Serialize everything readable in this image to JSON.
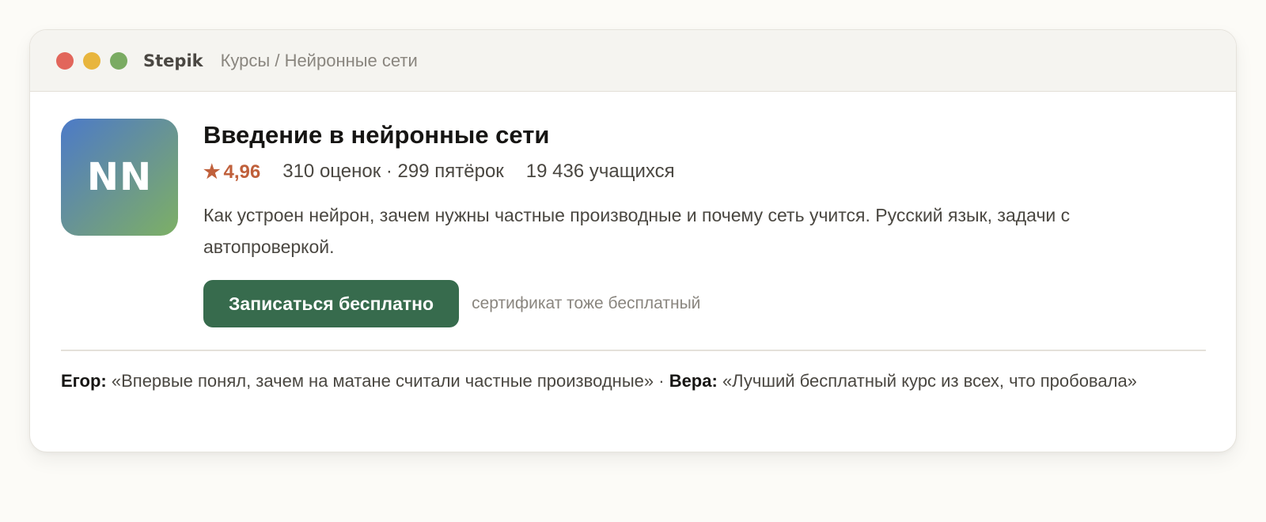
{
  "window": {
    "brand": "Stepik",
    "breadcrumb": "Курсы / Нейронные сети",
    "controls": [
      "close",
      "minimize",
      "maximize"
    ]
  },
  "course": {
    "logo_text": "NN",
    "title": "Введение в нейронные сети",
    "rating_star": "★",
    "rating": "4,96",
    "ratings_summary": "310 оценок · 299 пятёрок",
    "students": "19 436 учащихся",
    "description": "Как устроен нейрон, зачем нужны частные производные и почему сеть учится. Русский язык, задачи с автопроверкой.",
    "enroll_label": "Записаться бесплатно",
    "enroll_note": "сертификат тоже бесплатный"
  },
  "reviews": [
    {
      "author": "Егор:",
      "text": "«Впервые понял, зачем на матане считали частные производные»"
    },
    {
      "author": "Вера:",
      "text": "«Лучший бесплатный курс из всех, что пробовала»"
    }
  ],
  "review_separator": "·",
  "colors": {
    "accent": "#376b4d",
    "rating": "#c0603b",
    "close": "#e2665b",
    "minimize": "#e8b53d",
    "maximize": "#7aab62"
  }
}
